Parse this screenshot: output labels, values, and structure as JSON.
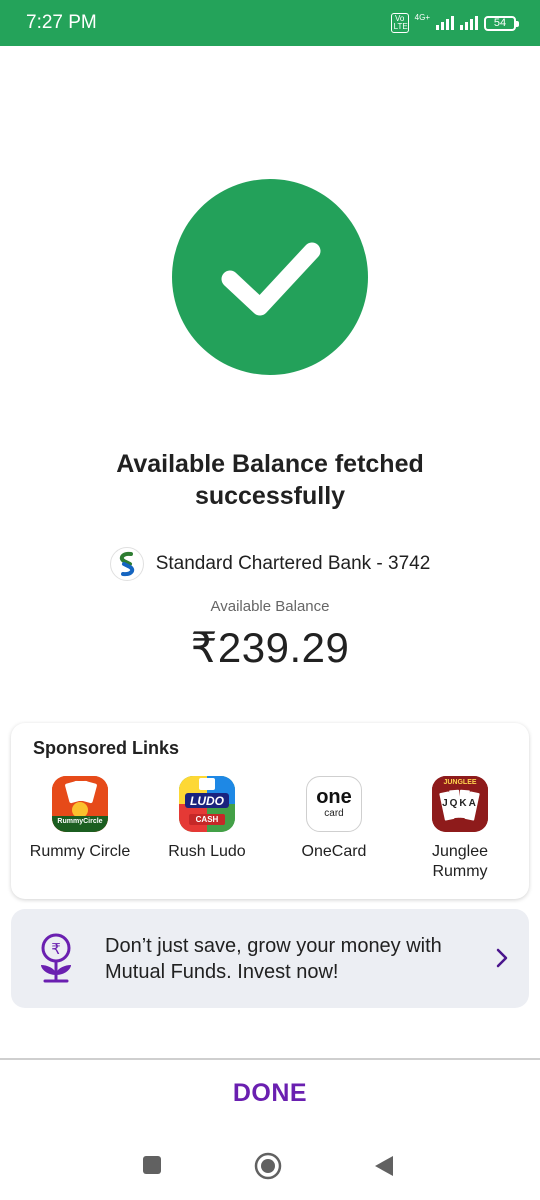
{
  "status_bar": {
    "time": "7:27 PM",
    "volte": "Vo LTE",
    "network": "4G+",
    "battery": "54"
  },
  "result": {
    "title": "Available Balance fetched successfully",
    "bank_name": "Standard Chartered Bank - 3742",
    "balance_label": "Available Balance",
    "balance_value": "₹239.29"
  },
  "sponsored": {
    "heading": "Sponsored Links",
    "apps": [
      {
        "label": "Rummy Circle",
        "icon": "rummy-circle-icon"
      },
      {
        "label": "Rush Ludo",
        "icon": "rush-ludo-icon"
      },
      {
        "label": "OneCard",
        "icon": "onecard-icon"
      },
      {
        "label": "Junglee Rummy",
        "icon": "junglee-rummy-icon"
      }
    ],
    "icon_texts": {
      "rummy": "RummyCircle",
      "ludo_top": "LUDO",
      "ludo_bottom": "CASH",
      "one_big": "one",
      "one_small": "card",
      "junglee_top": "JUNGLEE",
      "junglee_cards": "JQKA"
    }
  },
  "banner": {
    "text": "Don’t just save, grow your money with Mutual Funds. Invest now!"
  },
  "footer": {
    "done_label": "DONE"
  },
  "colors": {
    "status_bar": "#24a35a",
    "success_green": "#23a15a",
    "accent_purple": "#6a1fb0",
    "banner_bg": "#eceef3"
  }
}
